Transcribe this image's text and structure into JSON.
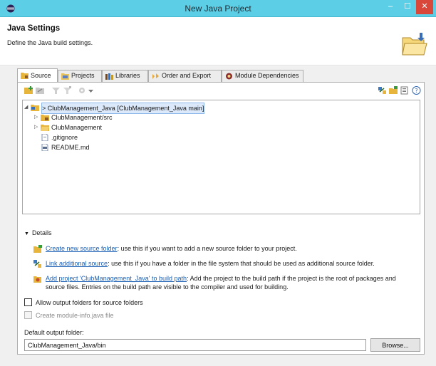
{
  "window": {
    "title": "New Java Project",
    "minimize_glyph": "–",
    "maximize_glyph": "☐",
    "close_glyph": "✕"
  },
  "header": {
    "title": "Java Settings",
    "description": "Define the Java build settings.",
    "icon": "folder-wizard-icon"
  },
  "tabs": [
    {
      "label": "Source",
      "icon": "source-folder-icon",
      "active": true
    },
    {
      "label": "Projects",
      "icon": "projects-icon",
      "active": false
    },
    {
      "label": "Libraries",
      "icon": "libraries-icon",
      "active": false
    },
    {
      "label": "Order and Export",
      "icon": "order-export-icon",
      "active": false
    },
    {
      "label": "Module Dependencies",
      "icon": "module-icon",
      "active": false
    }
  ],
  "tree": {
    "root": {
      "label": "> ClubManagement_Java [ClubManagement_Java main]",
      "toggle": "◢"
    },
    "items": [
      {
        "label": "ClubManagement/src",
        "toggle": "▷",
        "icon": "source-folder-icon"
      },
      {
        "label": "ClubManagement",
        "toggle": "▷",
        "icon": "folder-icon"
      },
      {
        "label": ".gitignore",
        "toggle": "",
        "icon": "file-icon"
      },
      {
        "label": "README.md",
        "toggle": "",
        "icon": "markdown-file-icon"
      }
    ]
  },
  "details": {
    "heading": "Details",
    "toggle": "▼",
    "create_source": {
      "link": "Create new source folder",
      "text": ": use this if you want to add a new source folder to your project."
    },
    "link_source": {
      "link": "Link additional source",
      "text": ": use this if you have a folder in the file system that should be used as additional source folder."
    },
    "add_project": {
      "link": "Add project 'ClubManagement_Java' to build path",
      "text": ": Add the project to the build path if the project is the root of packages and source files. Entries on the build path are visible to the compiler and used for building."
    }
  },
  "options": {
    "allow_output": {
      "label": "Allow output folders for source folders",
      "checked": false,
      "enabled": true
    },
    "module_info": {
      "label": "Create module-info.java file",
      "checked": false,
      "enabled": false
    }
  },
  "output": {
    "label": "Default output folder:",
    "value": "ClubManagement_Java/bin",
    "browse_label": "Browse..."
  },
  "colors": {
    "titlebar": "#5ccfe6",
    "close_button": "#d9463a",
    "link": "#1a5fb4",
    "folder": "#e8b53c"
  }
}
